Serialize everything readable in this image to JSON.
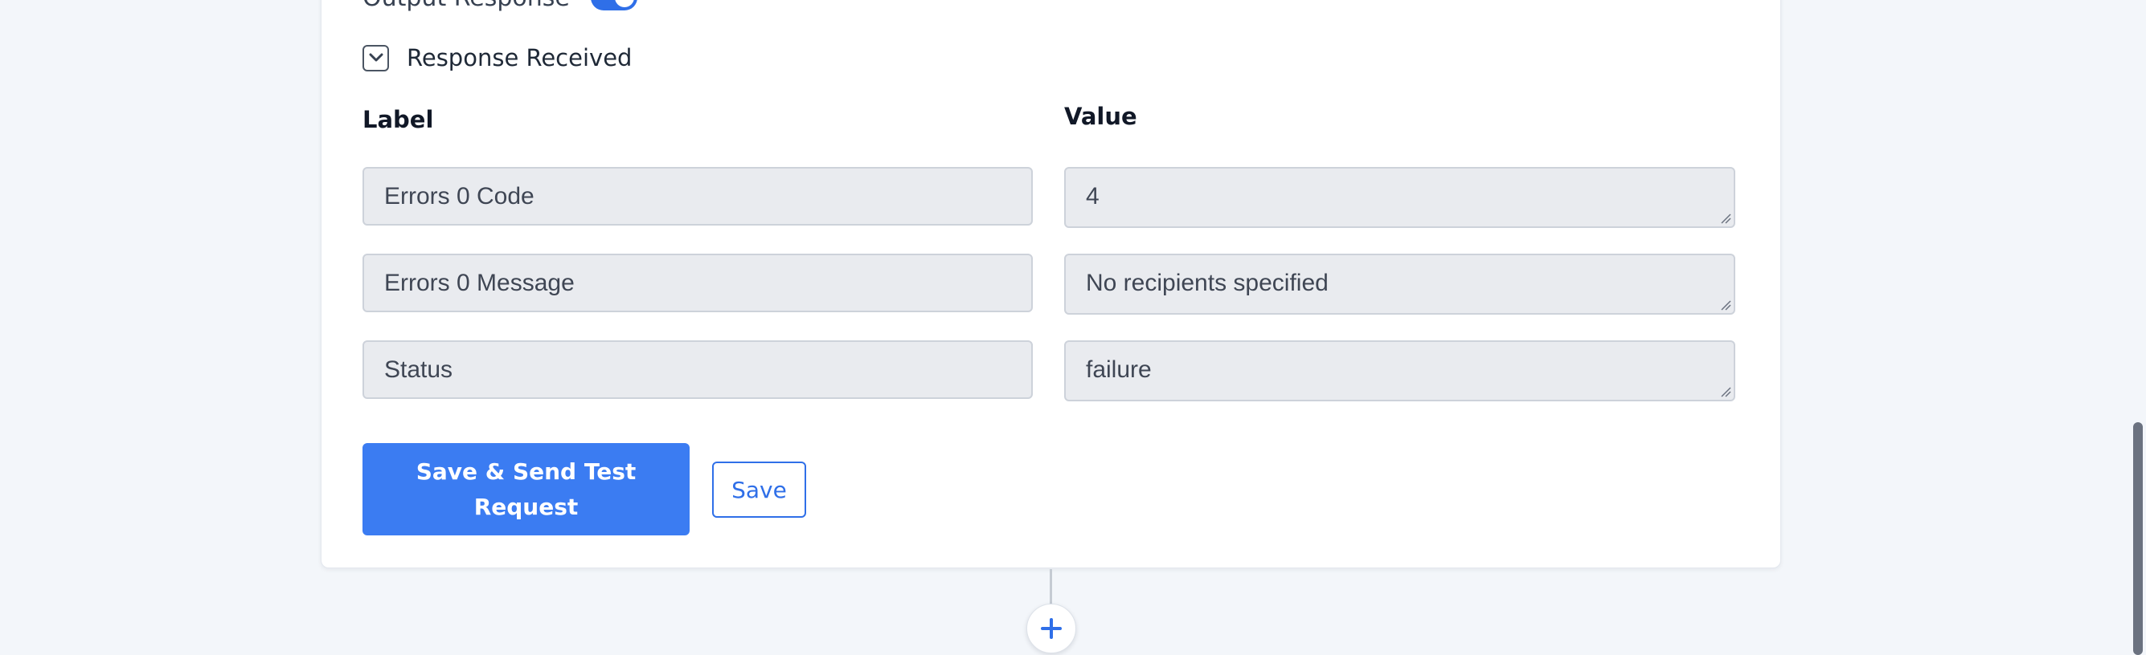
{
  "top_row": {
    "label": "Output Response"
  },
  "response": {
    "label": "Response Received"
  },
  "columns": {
    "label_header": "Label",
    "value_header": "Value"
  },
  "rows": [
    {
      "label": "Errors 0 Code",
      "value": "4"
    },
    {
      "label": "Errors 0 Message",
      "value": "No recipients specified"
    },
    {
      "label": "Status",
      "value": "failure"
    }
  ],
  "buttons": {
    "save_and_send": "Save & Send Test Request",
    "save": "Save"
  },
  "colors": {
    "accent": "#3b7cf2",
    "field_bg": "#e9ebef",
    "page_bg": "#f3f6fa"
  },
  "icons": {
    "response_toggle": "chevron-down-icon",
    "add_step": "plus-icon"
  }
}
